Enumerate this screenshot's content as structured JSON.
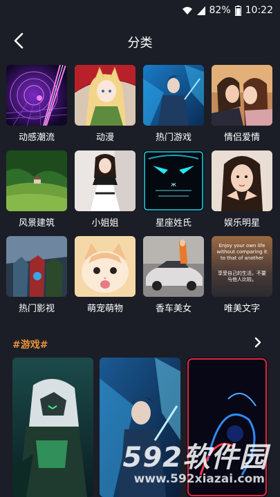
{
  "status_bar": {
    "battery": "82%",
    "time": "10:22"
  },
  "header": {
    "title": "分类"
  },
  "categories": [
    {
      "label": "动感潮流"
    },
    {
      "label": "动漫"
    },
    {
      "label": "热门游戏"
    },
    {
      "label": "情侣爱情"
    },
    {
      "label": "风景建筑"
    },
    {
      "label": "小姐姐"
    },
    {
      "label": "星座姓氏"
    },
    {
      "label": "娱乐明星"
    },
    {
      "label": "热门影视"
    },
    {
      "label": "萌宠萌物"
    },
    {
      "label": "香车美女"
    },
    {
      "label": "唯美文字"
    }
  ],
  "thumb_text": {
    "wenzi_en": "Enjoy your own life without comparing it to that of another",
    "wenzi_cn": "享受自己的生活，不要与他人比较。"
  },
  "section": {
    "title": "#游戏#"
  },
  "watermark": {
    "brand": "592软件园",
    "url": "www.592xiazai.com"
  }
}
